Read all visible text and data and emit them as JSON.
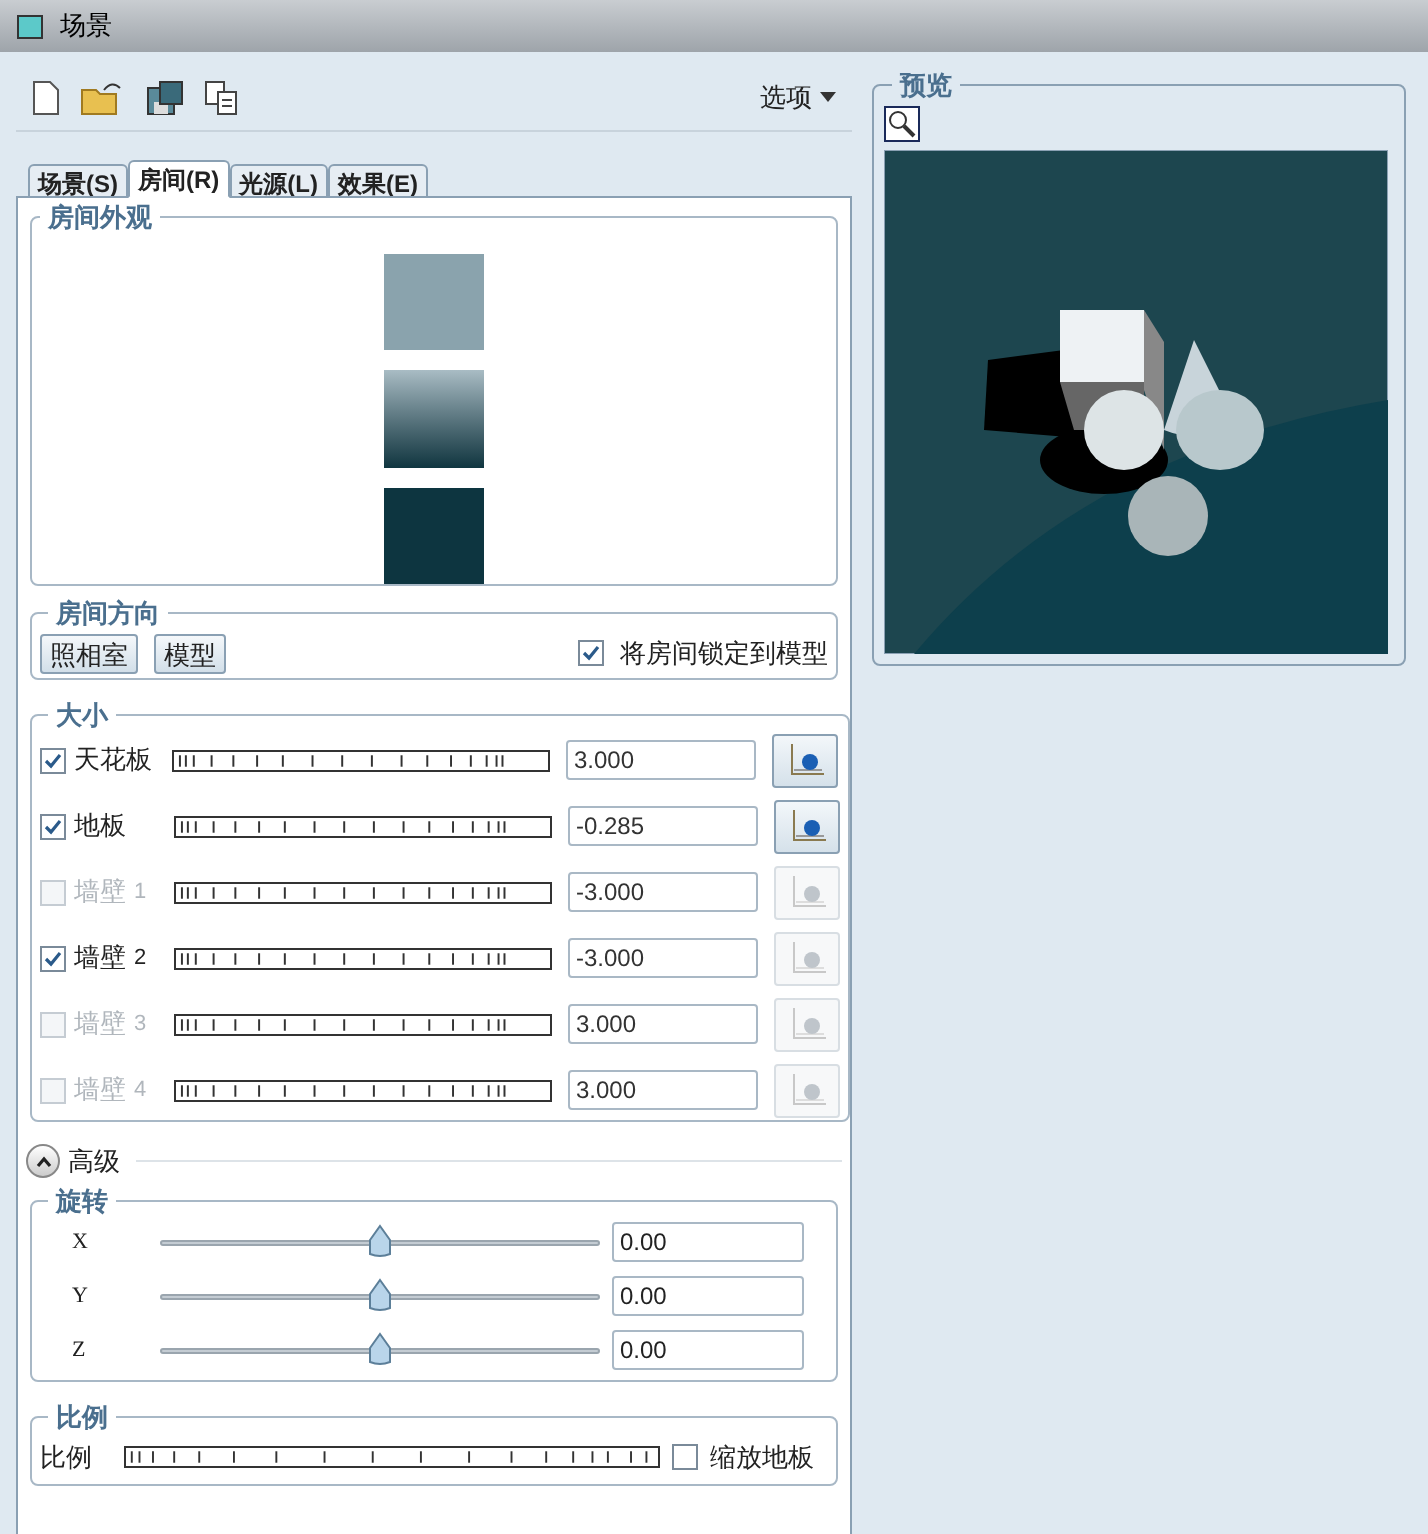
{
  "window": {
    "title": "场景"
  },
  "toolbar": {
    "options_menu": "选项"
  },
  "tabs": [
    {
      "label": "场景(S)",
      "selected": false
    },
    {
      "label": "房间(R)",
      "selected": true
    },
    {
      "label": "光源(L)",
      "selected": false
    },
    {
      "label": "效果(E)",
      "selected": false
    }
  ],
  "appearance": {
    "title": "房间外观"
  },
  "orientation": {
    "title": "房间方向",
    "buttons": [
      "照相室",
      "模型"
    ],
    "lock": {
      "label": "将房间锁定到模型",
      "checked": true
    }
  },
  "size": {
    "title": "大小",
    "rows": [
      {
        "label": "天花板",
        "checked": true,
        "value": "3.000",
        "picker_enabled": true
      },
      {
        "label": "地板",
        "checked": true,
        "value": "-0.285",
        "picker_enabled": true
      },
      {
        "label": "墙壁",
        "suffix": "1",
        "checked": false,
        "value": "-3.000",
        "picker_enabled": false
      },
      {
        "label": "墙壁",
        "suffix": "2",
        "checked": true,
        "value": "-3.000",
        "picker_enabled": false
      },
      {
        "label": "墙壁",
        "suffix": "3",
        "checked": false,
        "value": "3.000",
        "picker_enabled": false
      },
      {
        "label": "墙壁",
        "suffix": "4",
        "checked": false,
        "value": "3.000",
        "picker_enabled": false
      }
    ]
  },
  "advanced": {
    "label": "高级",
    "expanded": true
  },
  "rotation": {
    "title": "旋转",
    "axes": [
      {
        "label": "X",
        "level": 0.5,
        "value": "0.00"
      },
      {
        "label": "Y",
        "level": 0.5,
        "value": "0.00"
      },
      {
        "label": "Z",
        "level": 0.5,
        "value": "0.00"
      }
    ]
  },
  "scale": {
    "title": "比例",
    "label": "比例",
    "scale_floor": {
      "label": "缩放地板",
      "checked": false
    }
  },
  "preview": {
    "title": "预览"
  }
}
